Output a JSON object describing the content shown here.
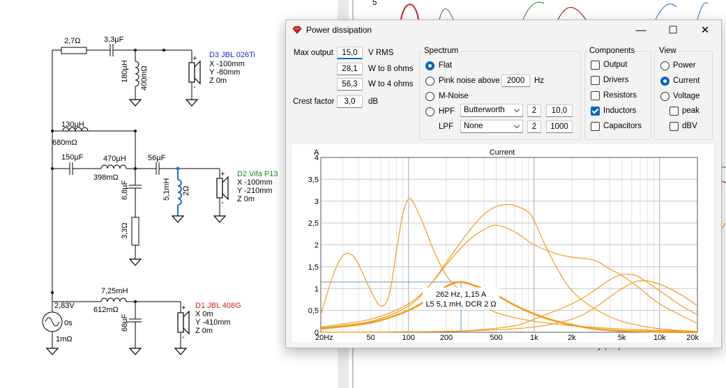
{
  "schematic": {
    "r1": "2,7Ω",
    "c1": "3,3µF",
    "l1": "180µH",
    "l1_dcr": "400mΩ",
    "d3_name": "D3 JBL 026Ti",
    "d3_x": "X -100mm",
    "d3_y": "Y -80mm",
    "d3_z": "Z 0m",
    "l2": "130µH",
    "l2_dcr": "680mΩ",
    "c2": "150µF",
    "l3": "470µH",
    "l3_dcr": "398mΩ",
    "c3": "56µF",
    "c4": "6,8µF",
    "r2": "3,3Ω",
    "l5": "5,1mH",
    "l5_dcr": "2Ω",
    "d2_name": "D2 Vifa P13",
    "d2_x": "X -100mm",
    "d2_y": "Y -210mm",
    "d2_z": "Z 0m",
    "l4": "7,25mH",
    "l4_dcr": "612mΩ",
    "c5": "68µF",
    "src_v": "2,83V",
    "src_t": "0s",
    "src_r": "1mΩ",
    "d1_name": "D1 JBL 408G",
    "d1_x": "X 0m",
    "d1_y": "Y -410mm",
    "d1_z": "Z 0m",
    "colors": {
      "d3": "#1f2bd1",
      "d2": "#1d8a1d",
      "d1": "#d81b1b",
      "l5": "#1f6fd1"
    }
  },
  "background": {
    "top_tick": "5",
    "bottom_label": "Directivity (hor)"
  },
  "window": {
    "title": "Power dissipation",
    "icon": "red-diamond-icon",
    "minimize": "—",
    "maximize": "☐",
    "close": "✕"
  },
  "inputs": {
    "max_output_label": "Max output",
    "max_output": "15,0",
    "max_output_unit": "V  RMS",
    "w8": "28,1",
    "w8_unit": "W to 8 ohms",
    "w4": "56,3",
    "w4_unit": "W to 4 ohms",
    "crest_label": "Crest factor",
    "crest": "3,0",
    "crest_unit": "dB"
  },
  "spectrum": {
    "legend": "Spectrum",
    "flat": "Flat",
    "pink": "Pink noise above",
    "pink_freq": "2000",
    "pink_unit": "Hz",
    "mnoise": "M-Noise",
    "hpf": "HPF",
    "hpf_type": "Butterworth",
    "hpf_order": "2",
    "hpf_freq": "10,0",
    "lpf": "LPF",
    "lpf_type": "None",
    "lpf_order": "2",
    "lpf_freq": "1000",
    "selected": "Flat"
  },
  "components": {
    "legend": "Components",
    "output": "Output",
    "drivers": "Drivers",
    "resistors": "Resistors",
    "inductors": "Inductors",
    "capacitors": "Capacitors",
    "checked": "Inductors"
  },
  "view": {
    "legend": "View",
    "power": "Power",
    "current": "Current",
    "voltage": "Voltage",
    "peak": "peak",
    "dbv": "dBV",
    "selected": "Current"
  },
  "chart_data": {
    "type": "line",
    "title": "Current",
    "ylabel": "A",
    "xscale": "log",
    "xlim": [
      20,
      20000
    ],
    "ylim": [
      0,
      4
    ],
    "xticks": [
      20,
      50,
      100,
      200,
      500,
      1000,
      2000,
      5000,
      10000,
      20000
    ],
    "xtick_labels": [
      "20Hz",
      "50",
      "100",
      "200",
      "500",
      "1k",
      "2k",
      "5k",
      "10k",
      "20k"
    ],
    "yticks": [
      0,
      0.5,
      1,
      1.5,
      2,
      2.5,
      3,
      3.5,
      4
    ],
    "ytick_labels": [
      "0",
      "0,5",
      "1",
      "1,5",
      "2",
      "2,5",
      "3",
      "3,5",
      "4"
    ],
    "line_color": "#f39c1e",
    "cursor_color": "#5b9bd5",
    "series": [
      {
        "x": [
          20,
          25,
          30,
          35,
          40,
          50,
          60,
          70,
          80,
          90,
          100,
          110,
          130,
          160,
          200,
          260,
          350,
          500,
          800,
          1200,
          2000,
          4000,
          8000,
          20000
        ],
        "y": [
          0.4,
          1.3,
          1.75,
          1.78,
          1.55,
          0.95,
          0.6,
          0.85,
          1.85,
          2.7,
          3.05,
          2.95,
          2.5,
          1.85,
          1.3,
          0.95,
          0.68,
          0.45,
          0.3,
          0.22,
          0.15,
          0.09,
          0.05,
          0.02
        ]
      },
      {
        "x": [
          20,
          50,
          100,
          150,
          200,
          260,
          350,
          500,
          700,
          1000,
          1500,
          2000,
          3000,
          5000,
          10000,
          20000
        ],
        "y": [
          0.08,
          0.22,
          0.5,
          0.8,
          1.05,
          1.15,
          1.05,
          0.85,
          0.62,
          0.42,
          0.25,
          0.17,
          0.08,
          0.03,
          0.01,
          0.0
        ]
      },
      {
        "x": [
          20,
          50,
          100,
          150,
          200,
          300,
          400,
          500,
          600,
          700,
          900,
          1000,
          1200,
          1500,
          2000,
          3000,
          5000,
          10000,
          20000
        ],
        "y": [
          0.1,
          0.25,
          0.6,
          1.1,
          1.6,
          2.3,
          2.7,
          2.88,
          2.92,
          2.9,
          2.75,
          2.55,
          2.05,
          1.5,
          0.95,
          0.55,
          0.25,
          0.08,
          0.02
        ]
      },
      {
        "x": [
          20,
          50,
          100,
          150,
          200,
          300,
          400,
          500,
          700,
          1000,
          1500,
          2000,
          3000,
          4000,
          5000,
          7000,
          10000,
          20000
        ],
        "y": [
          0.12,
          0.3,
          0.65,
          1.1,
          1.55,
          2.1,
          2.35,
          2.45,
          2.3,
          2.0,
          1.8,
          1.72,
          1.65,
          1.45,
          1.3,
          1.0,
          0.65,
          0.2
        ]
      },
      {
        "x": [
          20,
          100,
          300,
          700,
          1000,
          2000,
          3000,
          4000,
          5000,
          6000,
          7000,
          10000,
          15000,
          20000
        ],
        "y": [
          0.0,
          0.01,
          0.04,
          0.15,
          0.3,
          0.65,
          0.95,
          1.2,
          1.32,
          1.32,
          1.25,
          0.95,
          0.6,
          0.4
        ]
      },
      {
        "x": [
          20,
          100,
          300,
          1000,
          2000,
          3000,
          5000,
          7000,
          10000,
          15000,
          20000
        ],
        "y": [
          0.0,
          0.01,
          0.03,
          0.12,
          0.3,
          0.55,
          1.0,
          1.18,
          1.1,
          0.85,
          0.6
        ]
      }
    ],
    "cursor": {
      "x": 262,
      "y": 1.15
    },
    "annotation_line1": "262 Hz, 1,15 A",
    "annotation_line2": "L5 5,1 mH, DCR 2 Ω"
  }
}
